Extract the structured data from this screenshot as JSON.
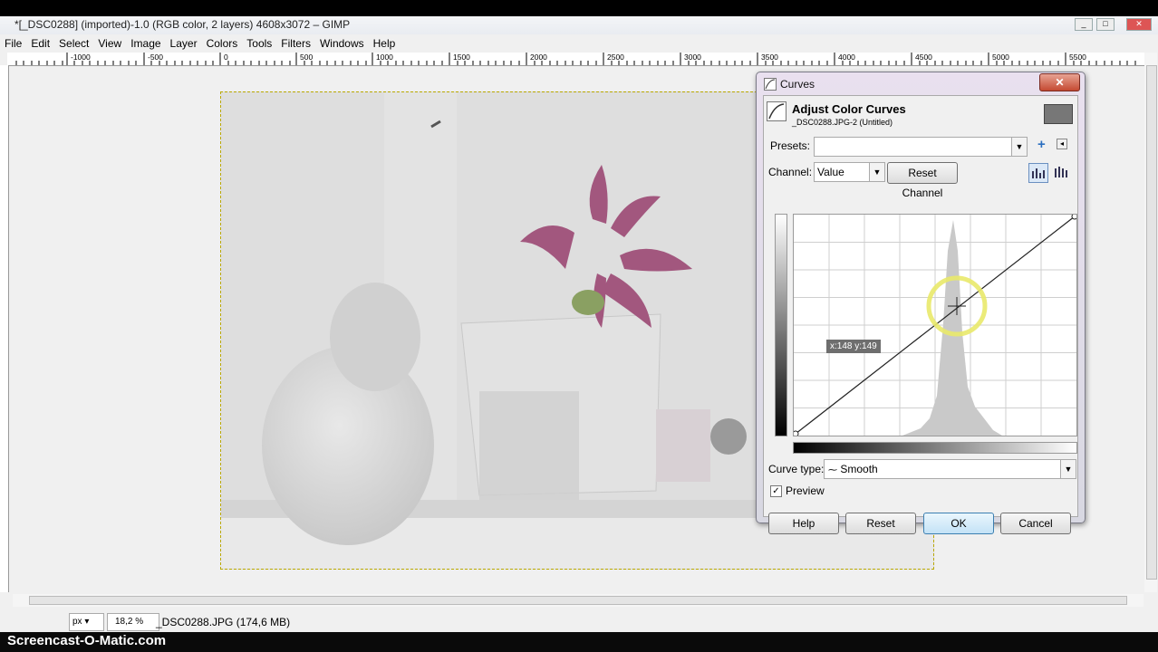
{
  "window": {
    "title": "*[_DSC0288] (imported)-1.0 (RGB color, 2 layers) 4608x3072 – GIMP",
    "controls": [
      "_",
      "□",
      "✕"
    ]
  },
  "menu": [
    "File",
    "Edit",
    "Select",
    "View",
    "Image",
    "Layer",
    "Colors",
    "Tools",
    "Filters",
    "Windows",
    "Help"
  ],
  "ruler": {
    "labels": [
      "-1000",
      "-500",
      "0",
      "500",
      "1000",
      "1500",
      "2000",
      "2500",
      "3000",
      "3500",
      "4000",
      "4500",
      "5000",
      "5500"
    ]
  },
  "status": {
    "unit": "px",
    "zoom": "18,2 %",
    "text": "_DSC0288.JPG (174,6 MB)"
  },
  "watermark": "Screencast-O-Matic.com",
  "dialog": {
    "title": "Curves",
    "close": "✕",
    "header": "Adjust Color Curves",
    "subheader": "_DSC0288.JPG-2 (Untitled)",
    "presets_label": "Presets:",
    "presets_value": "",
    "channel_label": "Channel:",
    "channel_value": "Value",
    "reset_channel": "Reset Channel",
    "coords": "x:148 y:149",
    "curve_type_label": "Curve type:",
    "curve_type_value": "Smooth",
    "preview_label": "Preview",
    "preview_checked": true,
    "buttons": {
      "help": "Help",
      "reset": "Reset",
      "ok": "OK",
      "cancel": "Cancel"
    }
  }
}
